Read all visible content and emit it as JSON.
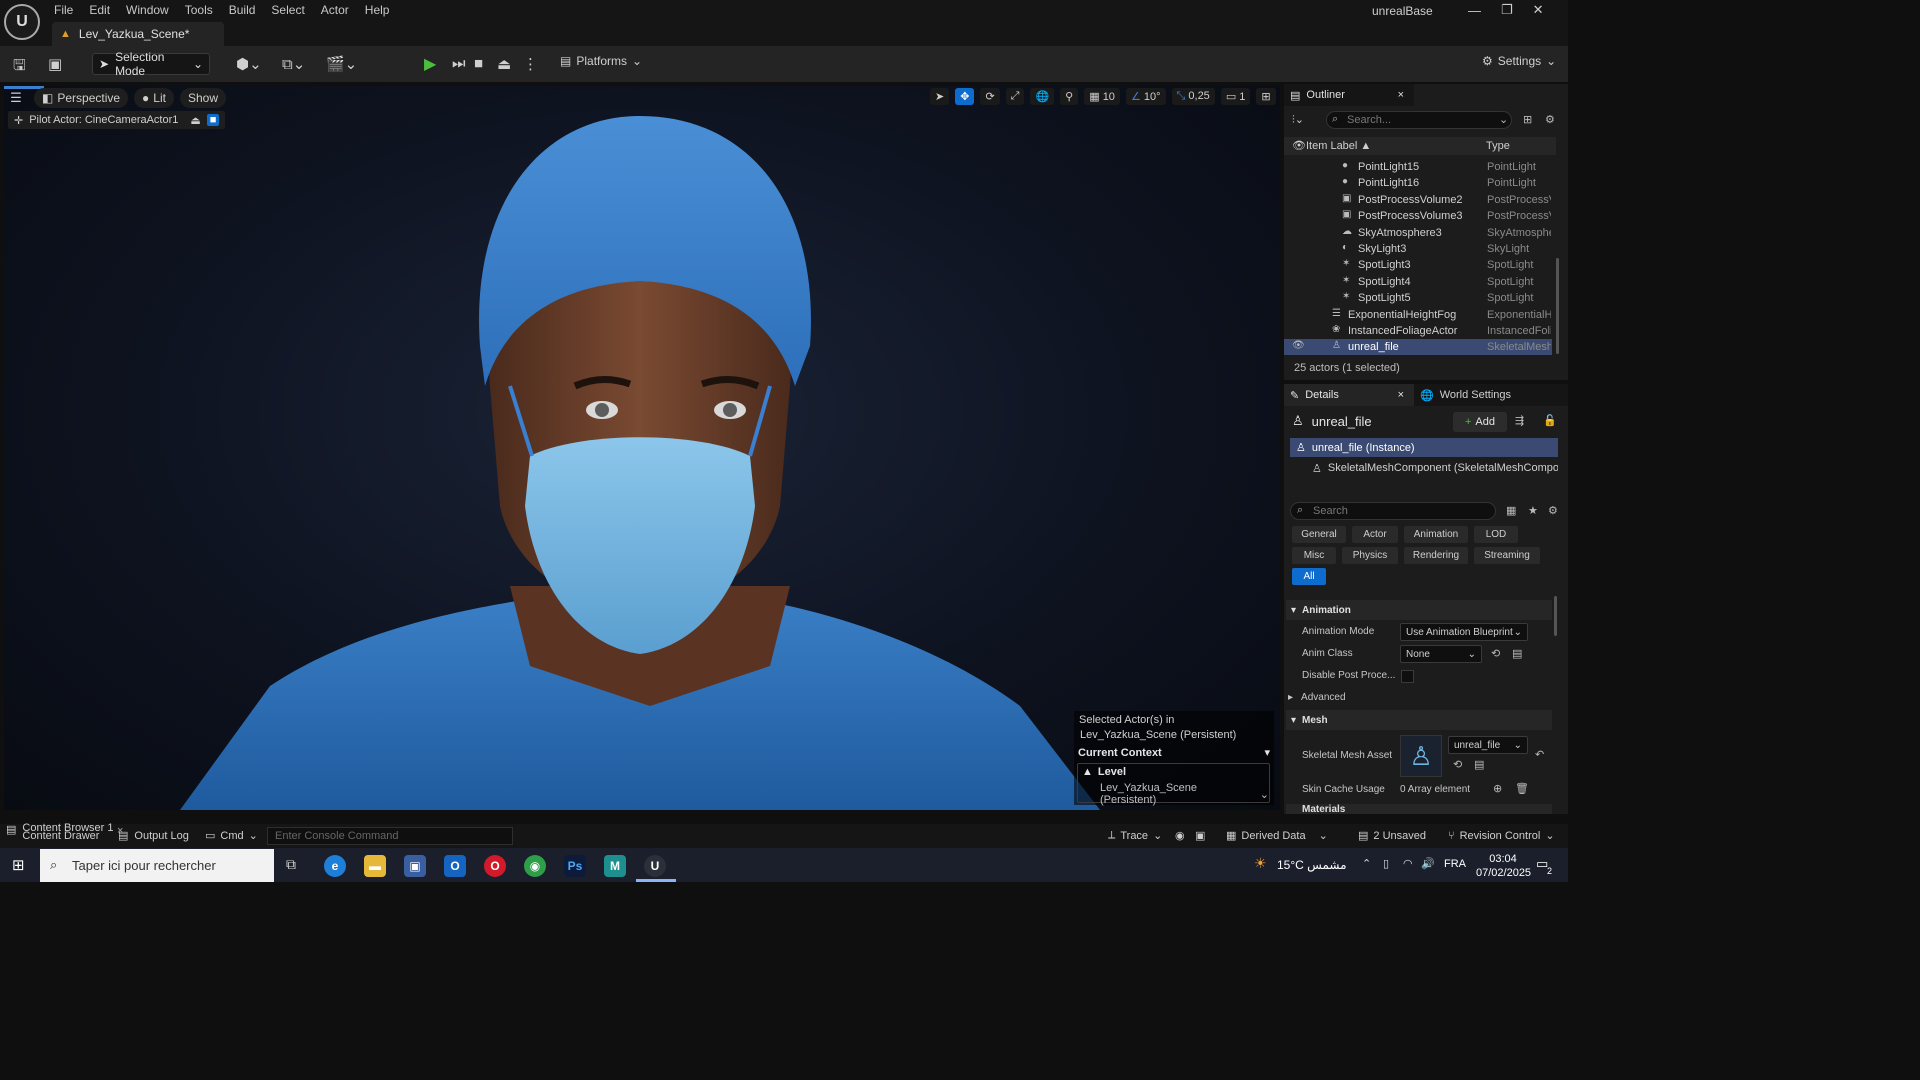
{
  "menu": [
    "File",
    "Edit",
    "Window",
    "Tools",
    "Build",
    "Select",
    "Actor",
    "Help"
  ],
  "level_tab": "Lev_Yazkua_Scene*",
  "project_name": "unrealBase",
  "toolbar": {
    "selection_mode": "Selection Mode",
    "platforms": "Platforms",
    "settings": "Settings"
  },
  "viewport": {
    "perspective": "Perspective",
    "lit": "Lit",
    "show": "Show",
    "pilot_actor": "Pilot Actor: CineCameraActor1",
    "grid_snap": "10",
    "rot_snap": "10°",
    "scale_snap": "0,25",
    "camera_speed": "1"
  },
  "context_popup": {
    "line1": "Selected Actor(s) in",
    "line2": "Lev_Yazkua_Scene (Persistent)",
    "current_context": "Current Context",
    "level_label": "Level",
    "level_value": "Lev_Yazkua_Scene (Persistent)"
  },
  "outliner": {
    "title": "Outliner",
    "search_placeholder": "Search...",
    "col_label": "Item Label ▲",
    "col_type": "Type",
    "rows": [
      {
        "label": "PointLight15",
        "type": "PointLight",
        "icon": "bulb-icon",
        "indent": 2
      },
      {
        "label": "PointLight16",
        "type": "PointLight",
        "icon": "bulb-icon",
        "indent": 2
      },
      {
        "label": "PostProcessVolume2",
        "type": "PostProcessV",
        "icon": "volume-icon",
        "indent": 2
      },
      {
        "label": "PostProcessVolume3",
        "type": "PostProcessV",
        "icon": "volume-icon",
        "indent": 2
      },
      {
        "label": "SkyAtmosphere3",
        "type": "SkyAtmosphe",
        "icon": "sky-icon",
        "indent": 2
      },
      {
        "label": "SkyLight3",
        "type": "SkyLight",
        "icon": "skylight-icon",
        "indent": 2
      },
      {
        "label": "SpotLight3",
        "type": "SpotLight",
        "icon": "spotlight-icon",
        "indent": 2
      },
      {
        "label": "SpotLight4",
        "type": "SpotLight",
        "icon": "spotlight-icon",
        "indent": 2
      },
      {
        "label": "SpotLight5",
        "type": "SpotLight",
        "icon": "spotlight-icon",
        "indent": 2
      },
      {
        "label": "ExponentialHeightFog",
        "type": "ExponentialHe",
        "icon": "fog-icon",
        "indent": 1
      },
      {
        "label": "InstancedFoliageActor",
        "type": "InstancedFolia",
        "icon": "foliage-icon",
        "indent": 1
      },
      {
        "label": "unreal_file",
        "type": "SkeletalMesh",
        "icon": "skeletal-icon",
        "indent": 1,
        "selected": true
      }
    ],
    "count": "25 actors (1 selected)"
  },
  "details": {
    "tab_details": "Details",
    "tab_world": "World Settings",
    "actor_name": "unreal_file",
    "add_label": "Add",
    "instance_row": "unreal_file (Instance)",
    "component_row": "SkeletalMeshComponent (SkeletalMeshCompone",
    "search_placeholder": "Search",
    "filters": [
      "General",
      "Actor",
      "Animation",
      "LOD",
      "Misc",
      "Physics",
      "Rendering",
      "Streaming",
      "All"
    ],
    "sec_animation": "Animation",
    "anim_mode_label": "Animation Mode",
    "anim_mode_value": "Use Animation Blueprint",
    "anim_class_label": "Anim Class",
    "anim_class_value": "None",
    "disable_post_label": "Disable Post Proce...",
    "advanced": "Advanced",
    "sec_mesh": "Mesh",
    "mesh_asset_label": "Skeletal Mesh Asset",
    "mesh_asset_value": "unreal_file",
    "skin_cache_label": "Skin Cache Usage",
    "skin_cache_value": "0 Array element",
    "sec_materials": "Materials"
  },
  "bottom": {
    "content_browser": "Content Browser 1",
    "content_drawer": "Content Drawer",
    "output_log": "Output Log",
    "cmd": "Cmd",
    "console_placeholder": "Enter Console Command",
    "trace": "Trace",
    "derived_data": "Derived Data",
    "unsaved": "2 Unsaved",
    "revision_control": "Revision Control"
  },
  "taskbar": {
    "search": "Taper ici pour rechercher",
    "weather": "15°C  مشمس",
    "lang": "FRA",
    "time": "03:04",
    "date": "07/02/2025",
    "notif": "2"
  },
  "colors": {
    "accent": "#0e6cce",
    "play_green": "#4bbf3c",
    "scrub_blue": "#3b7fd1",
    "mask_blue": "#6fb4de"
  }
}
